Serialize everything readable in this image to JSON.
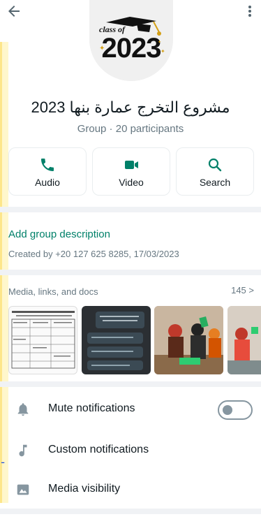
{
  "header": {
    "back_icon": "arrow-left-icon",
    "menu_icon": "more-vert-icon"
  },
  "avatar": {
    "line1": "class of",
    "line2": "2023"
  },
  "group": {
    "name": "مشروع التخرج عمارة بنها 2023",
    "meta": "Group · 20 participants"
  },
  "actions": [
    {
      "label": "Audio",
      "icon": "phone-icon"
    },
    {
      "label": "Video",
      "icon": "video-icon"
    },
    {
      "label": "Search",
      "icon": "search-icon"
    }
  ],
  "description": {
    "add_label": "Add group description",
    "created_by": "Created by +20 127 625 8285, 17/03/2023"
  },
  "media": {
    "title": "Media, links, and docs",
    "count": "145 >"
  },
  "settings": [
    {
      "label": "Mute notifications",
      "icon": "bell-icon"
    },
    {
      "label": "Custom notifications",
      "icon": "music-note-icon"
    },
    {
      "label": "Media visibility",
      "icon": "image-icon"
    }
  ],
  "colors": {
    "accent": "#008069",
    "muted": "#667781",
    "band": "#f0f2f5"
  }
}
